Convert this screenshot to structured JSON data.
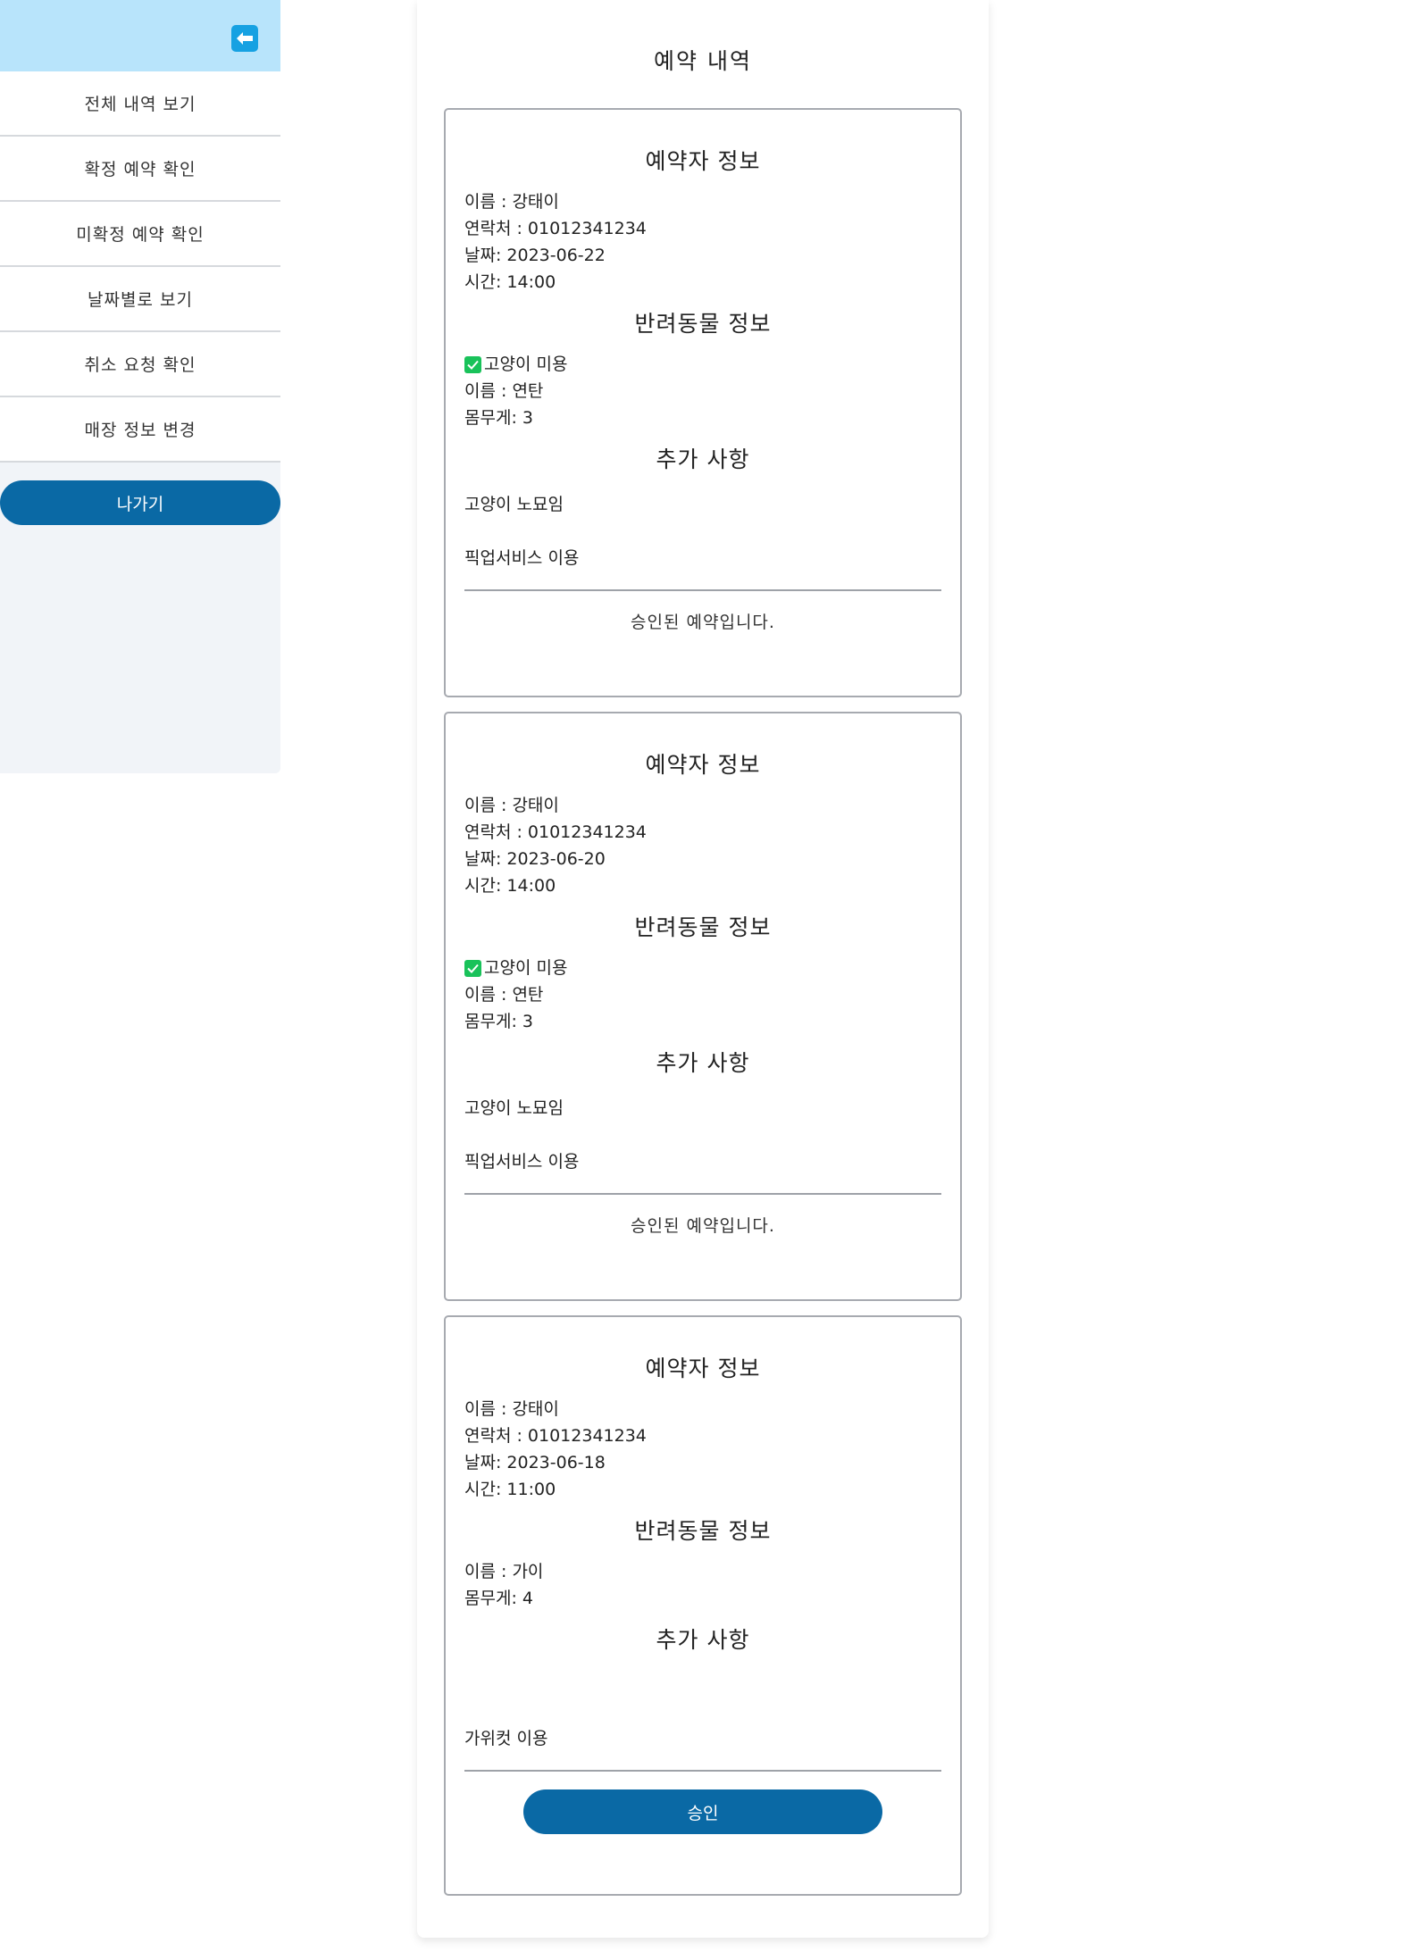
{
  "sidebar": {
    "back_icon": "arrow-left-icon",
    "items": [
      {
        "label": "전체 내역 보기"
      },
      {
        "label": "확정 예약 확인"
      },
      {
        "label": "미확정 예약 확인"
      },
      {
        "label": "날짜별로 보기"
      },
      {
        "label": "취소 요청 확인"
      },
      {
        "label": "매장 정보 변경"
      }
    ],
    "exit_label": "나가기"
  },
  "main": {
    "title": "예약 내역",
    "section_titles": {
      "reserver": "예약자 정보",
      "pet": "반려동물 정보",
      "extra": "추가 사항"
    },
    "reservations": [
      {
        "name": "이름 : 강태이",
        "phone": "연락처 : 01012341234",
        "date": "날짜: 2023-06-22",
        "time": "시간: 14:00",
        "service": "고양이 미용",
        "pet_name": "이름 : 연탄",
        "weight": "몸무게: 3",
        "extra_1": "고양이 노묘임",
        "extra_2": "픽업서비스 이용",
        "status": "승인된 예약입니다."
      },
      {
        "name": "이름 : 강태이",
        "phone": "연락처 : 01012341234",
        "date": "날짜: 2023-06-20",
        "time": "시간: 14:00",
        "service": "고양이 미용",
        "pet_name": "이름 : 연탄",
        "weight": "몸무게: 3",
        "extra_1": "고양이 노묘임",
        "extra_2": "픽업서비스 이용",
        "status": "승인된 예약입니다."
      },
      {
        "name": "이름 : 강태이",
        "phone": "연락처 : 01012341234",
        "date": "날짜: 2023-06-18",
        "time": "시간: 11:00",
        "pet_name": "이름 : 가이",
        "weight": "몸무게: 4",
        "extra_2": "가위컷 이용",
        "approve_label": "승인"
      }
    ]
  },
  "colors": {
    "sidebar_header": "#b8e4fb",
    "sidebar_bg": "#f1f4f8",
    "back_button": "#16a1e2",
    "primary_button": "#0a69a5",
    "check": "#19c25a"
  }
}
